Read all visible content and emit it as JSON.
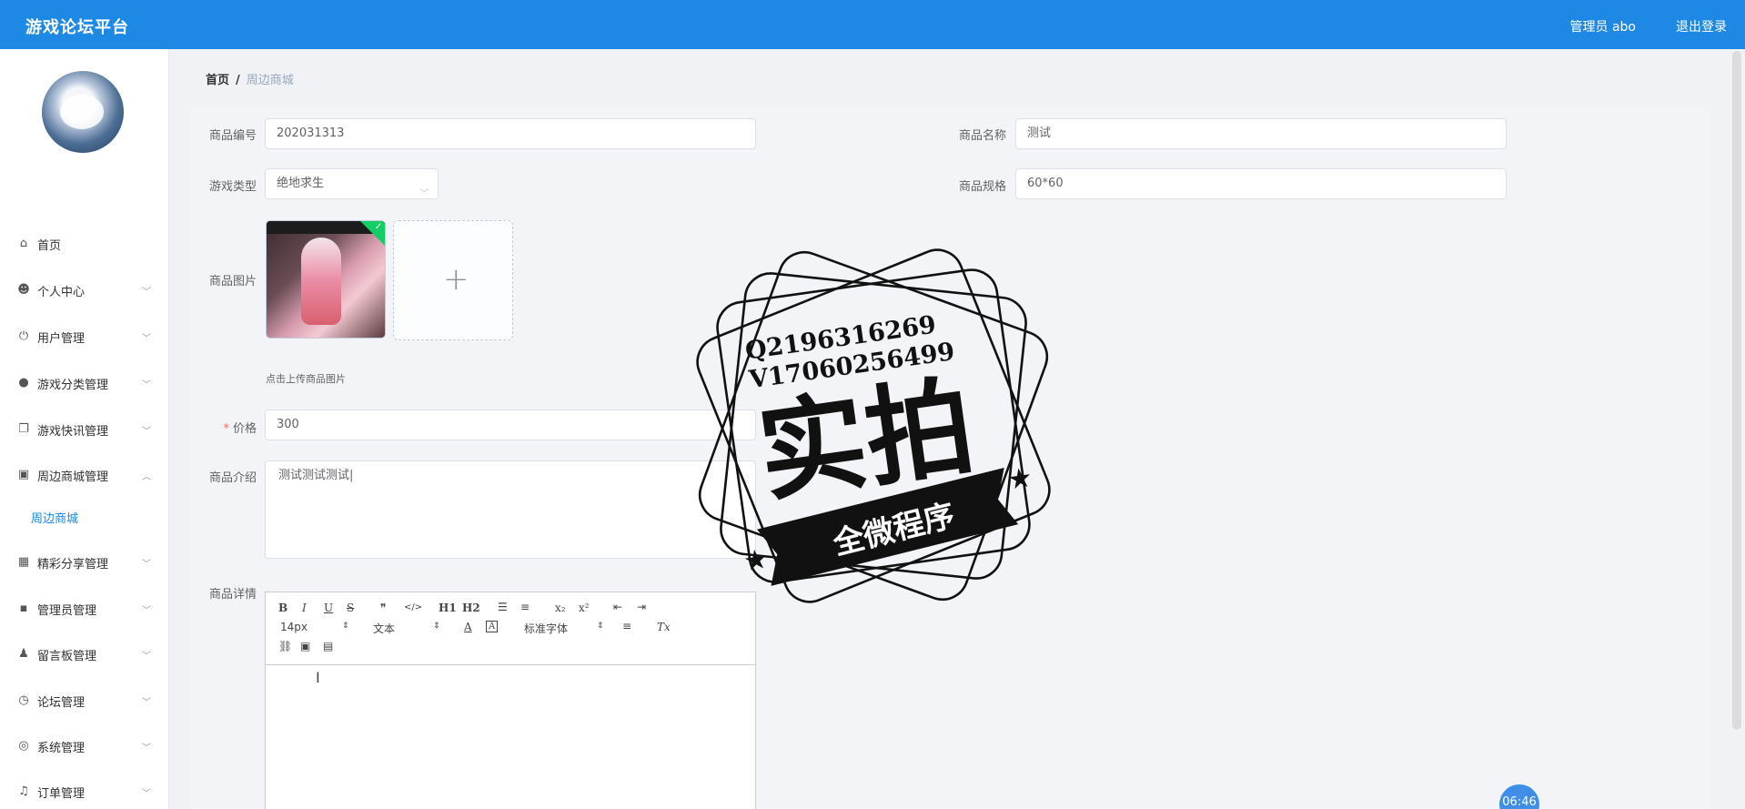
{
  "app": {
    "title": "游戏论坛平台"
  },
  "header": {
    "admin_label": "管理员 abo",
    "logout_label": "退出登录"
  },
  "sidebar": {
    "items": [
      {
        "label": "首页",
        "icon": "home-icon"
      },
      {
        "label": "个人中心",
        "icon": "user-icon"
      },
      {
        "label": "用户管理",
        "icon": "power-icon"
      },
      {
        "label": "游戏分类管理",
        "icon": "bulb-icon"
      },
      {
        "label": "游戏快讯管理",
        "icon": "copy-icon"
      },
      {
        "label": "周边商城管理",
        "icon": "chart-icon"
      },
      {
        "label": "精彩分享管理",
        "icon": "grid-icon"
      },
      {
        "label": "管理员管理",
        "icon": "chat-icon"
      },
      {
        "label": "留言板管理",
        "icon": "person-icon"
      },
      {
        "label": "论坛管理",
        "icon": "compass-icon"
      },
      {
        "label": "系统管理",
        "icon": "target-icon"
      },
      {
        "label": "订单管理",
        "icon": "bell-icon"
      }
    ],
    "active_sub_item": "周边商城"
  },
  "breadcrumb": {
    "home": "首页",
    "separator": "/",
    "current": "周边商城"
  },
  "form": {
    "code_label": "商品编号",
    "code_value": "202031313",
    "name_label": "商品名称",
    "name_value": "测试",
    "type_label": "游戏类型",
    "type_value": "绝地求生",
    "spec_label": "商品规格",
    "spec_value": "60*60",
    "image_label": "商品图片",
    "upload_plus": "+",
    "upload_hint": "点击上传商品图片",
    "price_required": "*",
    "price_label": "价格",
    "price_value": "300",
    "intro_label": "商品介绍",
    "intro_value": "测试测试测试|",
    "detail_label": "商品详情"
  },
  "editor_toolbar": {
    "bold": "B",
    "italic": "I",
    "underline": "U",
    "strike": "S",
    "quote": "❞",
    "code": "</>",
    "h1": "H1",
    "h2": "H2",
    "ordered_list": "☰",
    "bullet_list": "≡",
    "subscript": "x₂",
    "superscript": "x²",
    "outdent": "⇤",
    "indent": "⇥",
    "size_value": "14px",
    "header_value": "文本",
    "font_color": "A",
    "background_color": "A",
    "font_family_value": "标准字体",
    "align": "≡",
    "clean": "Tx",
    "link": "⛓",
    "image": "▣",
    "video": "▤"
  },
  "watermark": {
    "line1": "Q2196316269",
    "line2": "V17060256499",
    "main_text": "实拍",
    "ribbon_text": "全微程序"
  },
  "clock": {
    "time": "06:46"
  },
  "colors": {
    "topbar": "#1e88e5",
    "active_menu": "#1e88e5",
    "required": "#f56c6c"
  }
}
